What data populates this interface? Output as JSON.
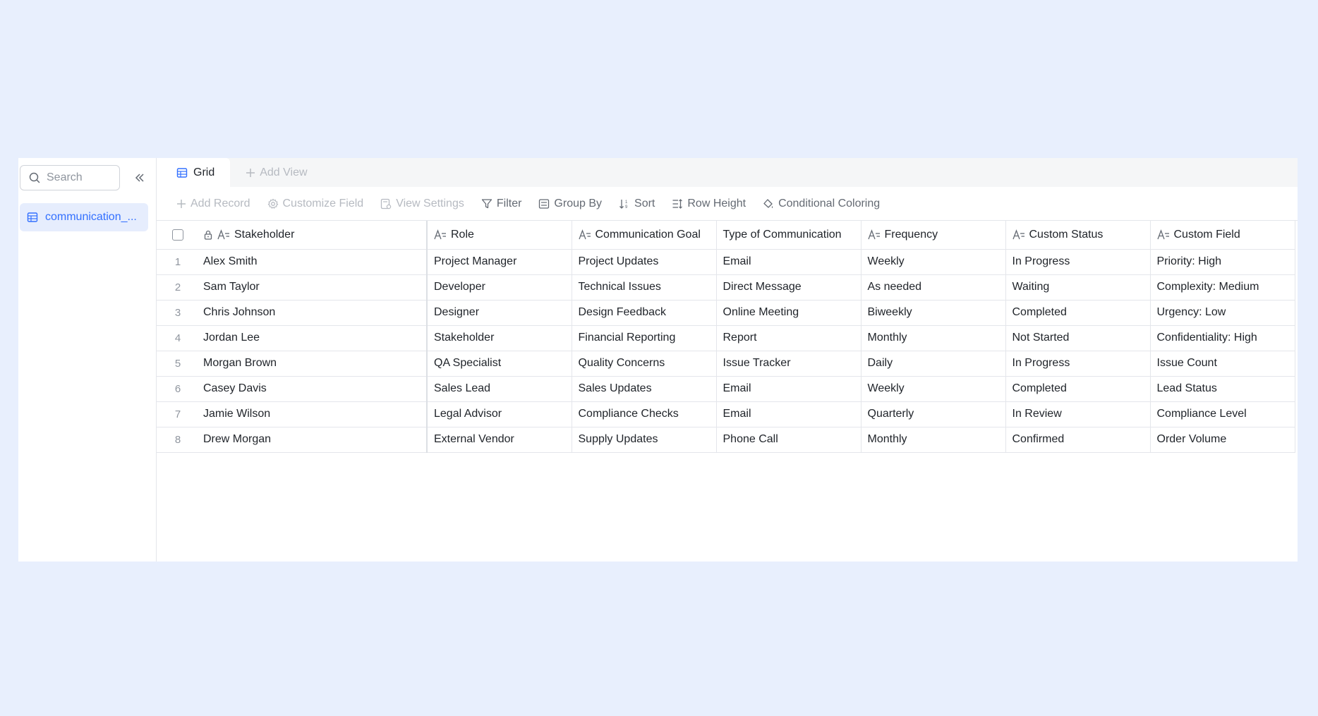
{
  "sidebar": {
    "search_placeholder": "Search",
    "table_name": "communication_..."
  },
  "tabs": {
    "grid_label": "Grid",
    "add_view_label": "Add View"
  },
  "toolbar": {
    "add_record": "Add Record",
    "customize_field": "Customize Field",
    "view_settings": "View Settings",
    "filter": "Filter",
    "group_by": "Group By",
    "sort": "Sort",
    "row_height": "Row Height",
    "conditional_coloring": "Conditional Coloring"
  },
  "columns": [
    "Stakeholder",
    "Role",
    "Communication Goal",
    "Type of Communication",
    "Frequency",
    "Custom Status",
    "Custom Field"
  ],
  "rows": [
    {
      "n": "1",
      "cells": [
        "Alex Smith",
        "Project Manager",
        "Project Updates",
        "Email",
        "Weekly",
        "In Progress",
        "Priority: High"
      ]
    },
    {
      "n": "2",
      "cells": [
        "Sam Taylor",
        "Developer",
        "Technical Issues",
        "Direct Message",
        "As needed",
        "Waiting",
        "Complexity: Medium"
      ]
    },
    {
      "n": "3",
      "cells": [
        "Chris Johnson",
        "Designer",
        "Design Feedback",
        "Online Meeting",
        "Biweekly",
        "Completed",
        "Urgency: Low"
      ]
    },
    {
      "n": "4",
      "cells": [
        "Jordan Lee",
        "Stakeholder",
        "Financial Reporting",
        "Report",
        "Monthly",
        "Not Started",
        "Confidentiality: High"
      ]
    },
    {
      "n": "5",
      "cells": [
        "Morgan Brown",
        "QA Specialist",
        "Quality Concerns",
        "Issue Tracker",
        "Daily",
        "In Progress",
        "Issue Count"
      ]
    },
    {
      "n": "6",
      "cells": [
        "Casey Davis",
        "Sales Lead",
        "Sales Updates",
        "Email",
        "Weekly",
        "Completed",
        "Lead Status"
      ]
    },
    {
      "n": "7",
      "cells": [
        "Jamie Wilson",
        "Legal Advisor",
        "Compliance Checks",
        "Email",
        "Quarterly",
        "In Review",
        "Compliance Level"
      ]
    },
    {
      "n": "8",
      "cells": [
        "Drew Morgan",
        "External Vendor",
        "Supply Updates",
        "Phone Call",
        "Monthly",
        "Confirmed",
        "Order Volume"
      ]
    }
  ],
  "colors": {
    "accent": "#3370ff",
    "background": "#e8effd"
  }
}
